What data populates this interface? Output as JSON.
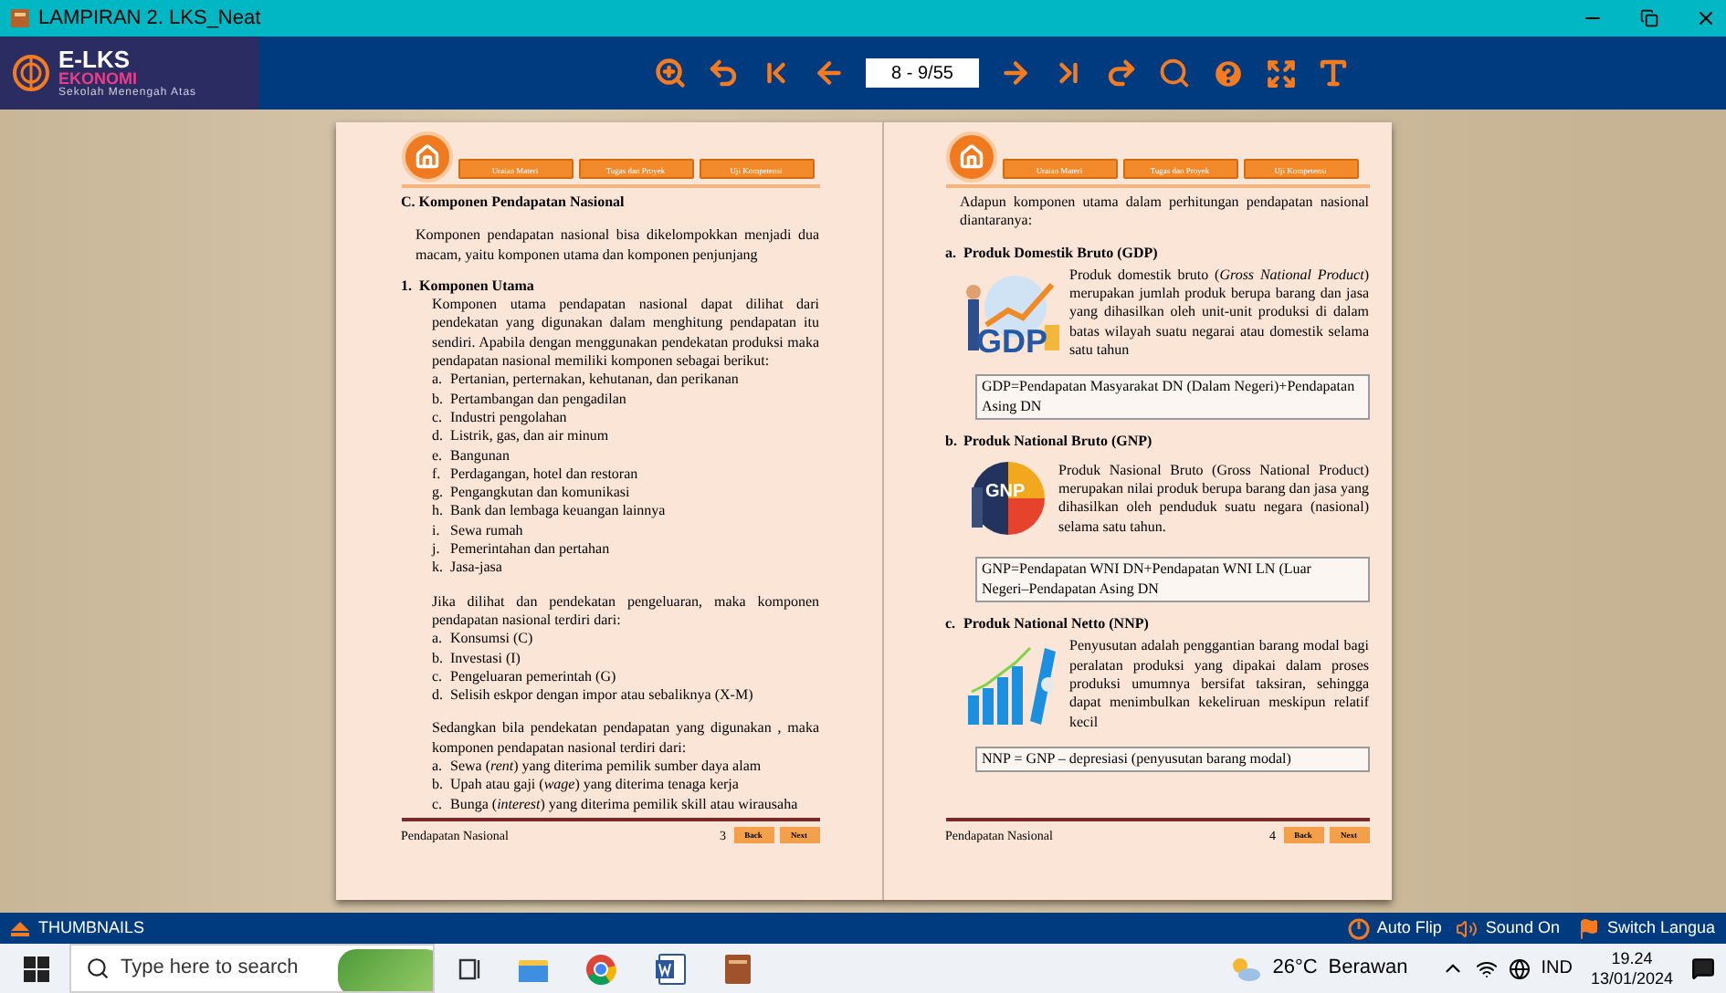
{
  "window": {
    "title": "LAMPIRAN 2. LKS_Neat"
  },
  "logo": {
    "title": "E-LKS",
    "subtitle": "EKONOMI",
    "tagline": "Sekolah Menengah Atas"
  },
  "toolbar": {
    "page_field": "8 - 9/55"
  },
  "pages": [
    {
      "nav": [
        "Uraian Materi",
        "Tugas dan Proyek",
        "Uji Kompetensi"
      ],
      "blocks": [
        {
          "kind": "heading",
          "text": "C. Komponen Pendapatan Nasional"
        },
        {
          "kind": "para",
          "text": "Komponen pendapatan nasional bisa dikelompokkan menjadi dua macam, yaitu komponen utama dan komponen penjunjang"
        },
        {
          "kind": "subheading",
          "marker": "1.",
          "text": "Komponen Utama"
        },
        {
          "kind": "subpara",
          "text": "Komponen utama pendapatan nasional dapat dilihat dari pendekatan yang digunakan dalam menghitung pendapatan itu sendiri. Apabila dengan menggunakan pendekatan produksi maka pendapatan nasional memiliki komponen sebagai berikut:"
        },
        {
          "kind": "list",
          "items": [
            {
              "marker": "a.",
              "text": "Pertanian, perternakan, kehutanan, dan perikanan"
            },
            {
              "marker": "b.",
              "text": "Pertambangan dan pengadilan"
            },
            {
              "marker": "c.",
              "text": "Industri pengolahan"
            },
            {
              "marker": "d.",
              "text": "Listrik, gas, dan air minum"
            },
            {
              "marker": "e.",
              "text": "Bangunan"
            },
            {
              "marker": "f.",
              "text": "Perdagangan, hotel dan restoran"
            },
            {
              "marker": "g.",
              "text": "Pengangkutan dan komunikasi"
            },
            {
              "marker": "h.",
              "text": "Bank dan lembaga keuangan lainnya"
            },
            {
              "marker": "i.",
              "text": "Sewa rumah"
            },
            {
              "marker": "j.",
              "text": "Pemerintahan dan pertahan"
            },
            {
              "marker": "k.",
              "text": "Jasa-jasa"
            }
          ]
        },
        {
          "kind": "subpara",
          "text": "Jika dilihat dan pendekatan pengeluaran, maka komponen pendapatan nasional terdiri dari:"
        },
        {
          "kind": "list",
          "items": [
            {
              "marker": "a.",
              "text": "Konsumsi (C)"
            },
            {
              "marker": "b.",
              "text": "Investasi (I)"
            },
            {
              "marker": "c.",
              "text": "Pengeluaran pemerintah (G)"
            },
            {
              "marker": "d.",
              "text": "Selisih eskpor dengan impor atau sebaliknya (X-M)"
            }
          ]
        },
        {
          "kind": "subpara",
          "text": "Sedangkan bila pendekatan pendapatan yang digunakan , maka komponen pendapatan nasional terdiri dari:"
        },
        {
          "kind": "list",
          "items": [
            {
              "marker": "a.",
              "text": "Sewa (*rent*) yang diterima pemilik sumber daya alam"
            },
            {
              "marker": "b.",
              "text": "Upah atau gaji (*wage*) yang diterima tenaga kerja"
            },
            {
              "marker": "c.",
              "text": "Bunga (*interest*) yang diterima pemilik skill atau wirausaha"
            }
          ]
        }
      ],
      "footer": {
        "title": "Pendapatan Nasional",
        "number": "3",
        "back": "Back",
        "next": "Next"
      }
    },
    {
      "nav": [
        "Uraian Materi",
        "Tugas dan Proyek",
        "Uji Kompetensi"
      ],
      "blocks": [
        {
          "kind": "para",
          "text": "Adapun komponen utama dalam perhitungan pendapatan nasional diantaranya:"
        },
        {
          "kind": "subheading",
          "marker": "a.",
          "text": "Produk Domestik Bruto (GDP)"
        },
        {
          "kind": "figure",
          "image": {
            "kind": "gdp",
            "label": "GDP"
          },
          "text": "Produk domestik bruto (*Gross National Product*) merupakan jumlah produk berupa barang dan jasa yang dihasilkan oleh unit-unit produksi di dalam batas wilayah suatu negarai atau domestik selama satu tahun"
        },
        {
          "kind": "formula",
          "text": "GDP=Pendapatan Masyarakat DN (Dalam Negeri)+Pendapatan Asing DN"
        },
        {
          "kind": "subheading",
          "marker": "b.",
          "text": "Produk National Bruto (GNP)"
        },
        {
          "kind": "figure",
          "image": {
            "kind": "gnp",
            "label": "GNP"
          },
          "text": "Produk Nasional Bruto (Gross National Product) merupakan nilai produk berupa barang dan jasa yang dihasilkan oleh penduduk suatu negara (nasional) selama satu tahun."
        },
        {
          "kind": "formula",
          "text": "GNP=Pendapatan WNI DN+Pendapatan WNI LN (Luar Negeri–Pendapatan Asing DN"
        },
        {
          "kind": "subheading",
          "marker": "c.",
          "text": "Produk National Netto (NNP)"
        },
        {
          "kind": "figure",
          "image": {
            "kind": "chart"
          },
          "text": "Penyusutan adalah penggantian barang modal bagi peralatan produksi yang dipakai dalam proses produksi umumnya bersifat taksiran, sehingga dapat menimbulkan kekeliruan meskipun relatif kecil"
        },
        {
          "kind": "formula",
          "text": "NNP = GNP – depresiasi (penyusutan barang modal)"
        }
      ],
      "footer": {
        "title": "Pendapatan Nasional",
        "number": "4",
        "back": "Back",
        "next": "Next"
      }
    }
  ],
  "bottom_bar": {
    "thumbnails": "THUMBNAILS",
    "auto_flip": "Auto Flip",
    "sound": "Sound On",
    "language": "Switch Langua"
  },
  "taskbar": {
    "search_placeholder": "Type here to search",
    "temperature": "26°C",
    "weather": "Berawan",
    "language": "IND",
    "time": "19.24",
    "date": "13/01/2024"
  }
}
